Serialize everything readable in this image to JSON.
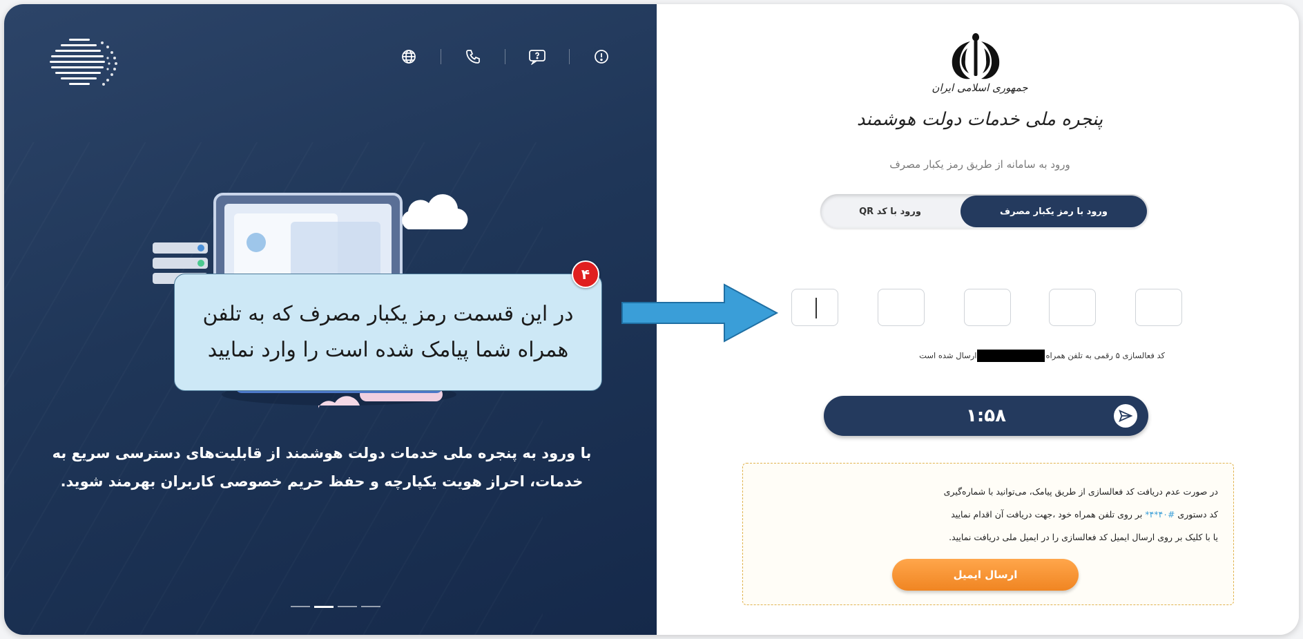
{
  "left_panel": {
    "promo_text": "با ورود به پنجره ملی خدمات دولت هوشمند از قابلیت‌های دسترسی سریع به خدمات، احراز هویت یکپارچه و حفظ حریم خصوصی کاربران بهرمند شوید.",
    "top_icons": [
      "globe-icon",
      "phone-icon",
      "chat-help-icon",
      "info-icon"
    ],
    "carousel": {
      "count": 4,
      "active": 2
    }
  },
  "callout": {
    "badge": "۴",
    "text": "در این قسمت رمز یکبار مصرف که به تلفن همراه شما پیامک شده است را وارد نمایید"
  },
  "right_panel": {
    "brand_line1": "جمهوری اسلامی ایران",
    "brand_line2": "پنجره ملی خدمات دولت هوشمند",
    "subtitle": "ورود به سامانه از طریق رمز یکبار مصرف",
    "tabs": {
      "otp_label": "ورود با رمز یکبار مصرف",
      "qr_label": "ورود با کد QR"
    },
    "otp": {
      "digits": [
        "",
        "",
        "",
        "",
        ""
      ]
    },
    "note_before": "کد فعالسازی ۵ رقمی به تلفن همراه",
    "note_after": "ارسال شده است",
    "timer": "۱:۵۸",
    "notice": {
      "line1": "در صورت عدم دریافت کد فعالسازی از طریق پیامک، می‌توانید با شماره‌گیری",
      "line2_before": "کد دستوری",
      "line2_code": "#۴۰*۴*",
      "line2_after": "بر روی تلفن همراه خود ،جهت دریافت آن اقدام نمایید",
      "line3": "یا با کلیک بر روی ارسال ایمیل کد فعالسازی را در ایمیل ملی دریافت نمایید.",
      "email_button": "ارسال ایمیل"
    }
  },
  "colors": {
    "navy": "#243a5e",
    "orange": "#f08522",
    "callout_bg": "#cde8f6",
    "arrow": "#3a9ed8",
    "badge": "#e01f1f"
  }
}
